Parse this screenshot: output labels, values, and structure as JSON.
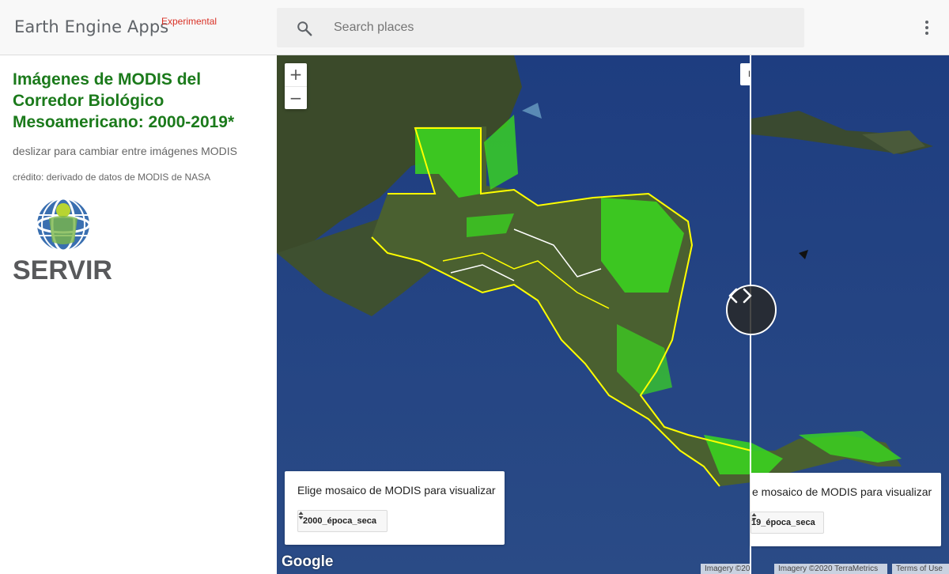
{
  "header": {
    "brand": "Earth Engine Apps",
    "badge": "Experimental",
    "search_placeholder": "Search places",
    "search_icon": "search-icon",
    "menu_icon": "more-vert-icon"
  },
  "panel": {
    "title": "Imágenes de MODIS del Corredor Biológico Mesoamericano: 2000-2019*",
    "description": "deslizar para cambiar entre imágenes MODIS",
    "credit": "crédito: derivado de datos de MODIS de NASA",
    "logo_text": "SERVIR"
  },
  "map": {
    "zoom_in": "+",
    "zoom_out": "−",
    "layer_tab": "L",
    "left_card": {
      "label": "Elige mosaico de MODIS para visualizar",
      "selected": "2000_época_seca"
    },
    "right_card": {
      "label": "e mosaico de MODIS para visualizar",
      "selected": "19_época_seca"
    },
    "google_logo": "Google",
    "attribution_left": "Imagery ©20",
    "attribution_right": "Imagery ©2020 TerraMetrics",
    "terms": "Terms of Use"
  },
  "colors": {
    "title_green": "#1b7a1b",
    "badge_red": "#d93025",
    "ocean": "#24407a",
    "vegetation": "#3ad81f",
    "boundary": "#ffff00"
  }
}
